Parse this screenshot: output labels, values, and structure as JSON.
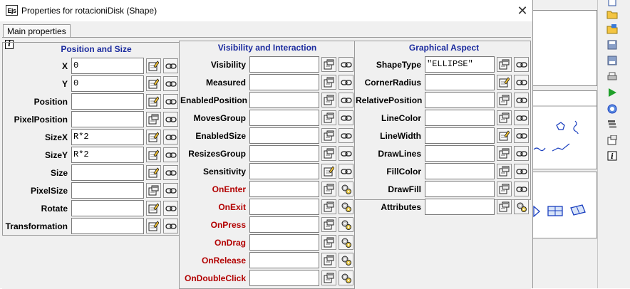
{
  "dialog": {
    "app_icon": "Ejs",
    "title": "Properties for rotacioniDisk (Shape)",
    "close_symbol": "✕",
    "tab": "Main properties",
    "info_icon": "i"
  },
  "columns": {
    "position": {
      "header": "Position and Size",
      "rows": [
        {
          "label": "X",
          "value": "0",
          "button1": "edit-icon",
          "button2": "link-icon"
        },
        {
          "label": "Y",
          "value": "0",
          "button1": "edit-icon",
          "button2": "link-icon"
        },
        {
          "label": "Position",
          "value": "",
          "button1": "edit-icon",
          "button2": "link-icon"
        },
        {
          "label": "PixelPosition",
          "value": "",
          "button1": "form-icon",
          "button2": "link-icon"
        },
        {
          "label": "SizeX",
          "value": "R*2",
          "button1": "edit-icon",
          "button2": "link-icon"
        },
        {
          "label": "SizeY",
          "value": "R*2",
          "button1": "edit-icon",
          "button2": "link-icon"
        },
        {
          "label": "Size",
          "value": "",
          "button1": "edit-icon",
          "button2": "link-icon"
        },
        {
          "label": "PixelSize",
          "value": "",
          "button1": "form-icon",
          "button2": "link-icon"
        },
        {
          "label": "Rotate",
          "value": "",
          "button1": "edit-icon",
          "button2": "link-icon"
        },
        {
          "label": "Transformation",
          "value": "",
          "button1": "edit-icon",
          "button2": "link-icon"
        }
      ]
    },
    "visibility": {
      "header": "Visibility and Interaction",
      "rows": [
        {
          "label": "Visibility",
          "value": "",
          "event": false,
          "button1": "form-icon",
          "button2": "link-icon"
        },
        {
          "label": "Measured",
          "value": "",
          "event": false,
          "button1": "form-icon",
          "button2": "link-icon"
        },
        {
          "label": "EnabledPosition",
          "value": "",
          "event": false,
          "button1": "form-icon",
          "button2": "link-icon"
        },
        {
          "label": "MovesGroup",
          "value": "",
          "event": false,
          "button1": "form-icon",
          "button2": "link-icon"
        },
        {
          "label": "EnabledSize",
          "value": "",
          "event": false,
          "button1": "form-icon",
          "button2": "link-icon"
        },
        {
          "label": "ResizesGroup",
          "value": "",
          "event": false,
          "button1": "form-icon",
          "button2": "link-icon"
        },
        {
          "label": "Sensitivity",
          "value": "",
          "event": false,
          "button1": "edit-icon",
          "button2": "link-icon"
        },
        {
          "label": "OnEnter",
          "value": "",
          "event": true,
          "button1": "form-icon",
          "button2": "gears-icon"
        },
        {
          "label": "OnExit",
          "value": "",
          "event": true,
          "button1": "form-icon",
          "button2": "gears-icon"
        },
        {
          "label": "OnPress",
          "value": "",
          "event": true,
          "button1": "form-icon",
          "button2": "gears-icon"
        },
        {
          "label": "OnDrag",
          "value": "",
          "event": true,
          "button1": "form-icon",
          "button2": "gears-icon"
        },
        {
          "label": "OnRelease",
          "value": "",
          "event": true,
          "button1": "form-icon",
          "button2": "gears-icon"
        },
        {
          "label": "OnDoubleClick",
          "value": "",
          "event": true,
          "button1": "form-icon",
          "button2": "gears-icon"
        }
      ]
    },
    "graphical": {
      "header": "Graphical Aspect",
      "rows": [
        {
          "label": "ShapeType",
          "value": "\"ELLIPSE\"",
          "button1": "form-icon",
          "button2": "link-icon"
        },
        {
          "label": "CornerRadius",
          "value": "",
          "button1": "edit-icon",
          "button2": "link-icon"
        },
        {
          "label": "RelativePosition",
          "value": "",
          "button1": "form-icon",
          "button2": "link-icon"
        },
        {
          "label": "LineColor",
          "value": "",
          "button1": "form-icon",
          "button2": "link-icon"
        },
        {
          "label": "LineWidth",
          "value": "",
          "button1": "edit-icon",
          "button2": "link-icon"
        },
        {
          "label": "DrawLines",
          "value": "",
          "button1": "form-icon",
          "button2": "link-icon"
        },
        {
          "label": "FillColor",
          "value": "",
          "button1": "form-icon",
          "button2": "link-icon"
        },
        {
          "label": "DrawFill",
          "value": "",
          "button1": "form-icon",
          "button2": "link-icon"
        },
        {
          "label": "Attributes",
          "value": "",
          "button1": "form-icon",
          "button2": "gears-icon"
        }
      ]
    }
  },
  "background_toolbar": {
    "icons": [
      "new-file-icon",
      "open-folder-icon",
      "open-folder-icon",
      "save-icon",
      "save-as-icon",
      "print-icon",
      "run-icon",
      "search-icon",
      "stack-icon",
      "settings-icon",
      "info-icon"
    ]
  },
  "colors": {
    "header": "#1a2a9e",
    "event_label": "#b20000",
    "panel_background": "#f0f0f0"
  }
}
